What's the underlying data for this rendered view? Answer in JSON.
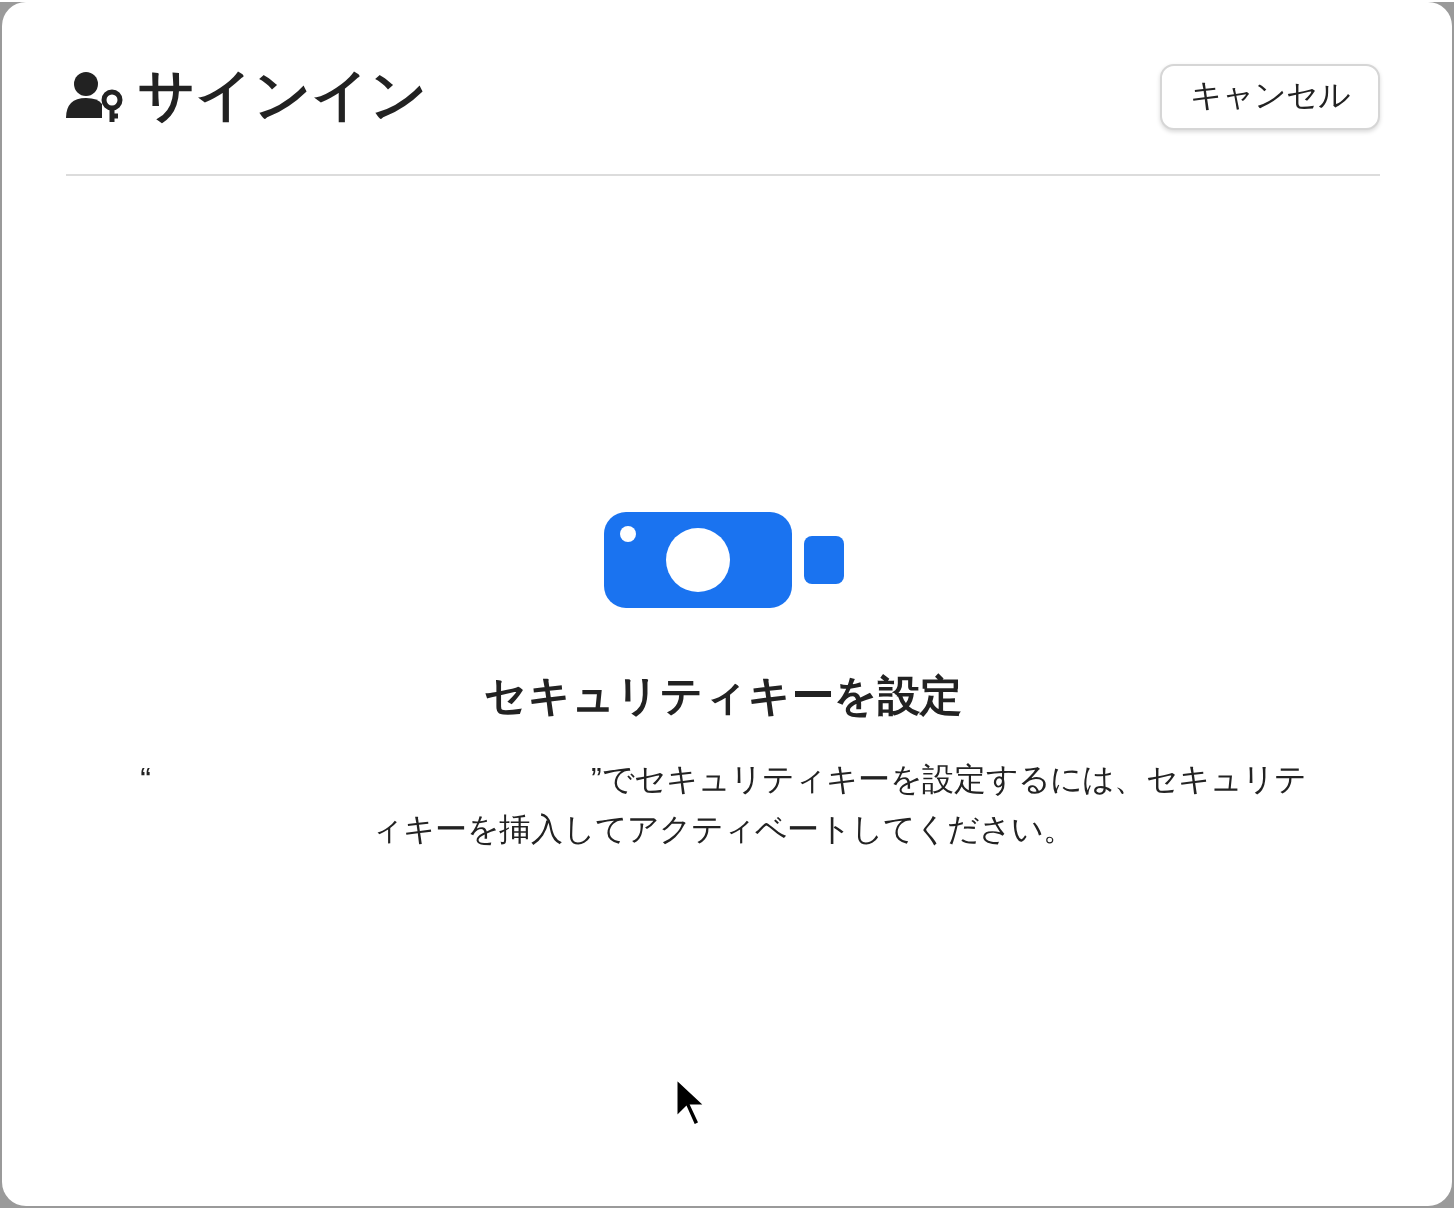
{
  "dialog": {
    "title": "サインイン",
    "cancel_button": "キャンセル"
  },
  "content": {
    "heading": "セキュリティキーを設定",
    "message_open": "“",
    "message_rest": "”でセキュリティキーを設定するには、セキュリティキーを挿入してアクティベートしてください。"
  }
}
